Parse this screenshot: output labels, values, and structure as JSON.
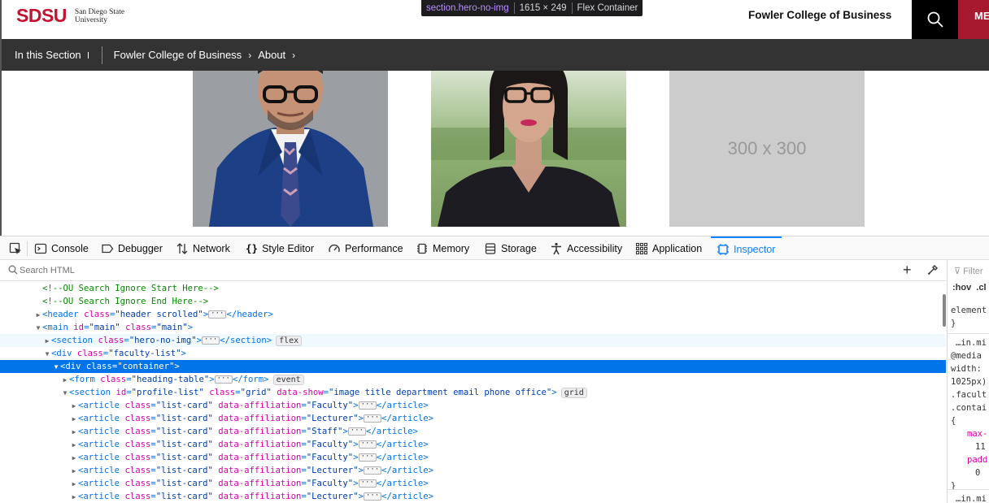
{
  "site": {
    "logo_text": "SDSU",
    "logo_sub_line1": "San Diego State",
    "logo_sub_line2": "University",
    "college_name": "Fowler College of Business",
    "menu_label": "ME",
    "in_this_section": "In this Section",
    "breadcrumbs": [
      "Fowler College of Business",
      "About"
    ],
    "placeholder_image_text": "300 x 300"
  },
  "tooltip": {
    "selector": "section.hero-no-img",
    "dimensions": "1615 × 249",
    "kind": "Flex Container"
  },
  "devtools": {
    "tabs": [
      {
        "label": "Console",
        "icon": "console-icon"
      },
      {
        "label": "Debugger",
        "icon": "debugger-icon"
      },
      {
        "label": "Network",
        "icon": "network-icon"
      },
      {
        "label": "Style Editor",
        "icon": "style-editor-icon"
      },
      {
        "label": "Performance",
        "icon": "performance-icon"
      },
      {
        "label": "Memory",
        "icon": "memory-icon"
      },
      {
        "label": "Storage",
        "icon": "storage-icon"
      },
      {
        "label": "Accessibility",
        "icon": "accessibility-icon"
      },
      {
        "label": "Application",
        "icon": "application-icon"
      },
      {
        "label": "Inspector",
        "icon": "inspector-icon",
        "active": true
      }
    ],
    "search_placeholder": "Search HTML",
    "rules_panel": {
      "filter_placeholder": "Filter",
      "hov": ":hov",
      "cls": ".cl",
      "lines": [
        "element",
        "}",
        "…in.mi",
        "@media",
        "width:",
        "1025px)",
        ".facult",
        ".contai",
        "{",
        "max-",
        "11",
        "padd",
        "0",
        "}",
        "…in.mi"
      ]
    },
    "tree": [
      {
        "indent": 0,
        "type": "comment",
        "text": "<!--OU Search Ignore Start Here-->"
      },
      {
        "indent": 0,
        "type": "comment",
        "text": "<!--OU Search Ignore End Here-->"
      },
      {
        "indent": 0,
        "toggle": "▶",
        "tag": "header",
        "attrs": [
          [
            "class",
            "header scrolled"
          ]
        ],
        "collapsed": true
      },
      {
        "indent": 0,
        "toggle": "▼",
        "tag": "main",
        "attrs": [
          [
            "id",
            "main"
          ],
          [
            "class",
            "main"
          ]
        ]
      },
      {
        "indent": 1,
        "toggle": "▶",
        "tag": "section",
        "attrs": [
          [
            "class",
            "hero-no-img"
          ]
        ],
        "collapsed": true,
        "badge": "flex",
        "hover": true
      },
      {
        "indent": 1,
        "toggle": "▼",
        "tag": "div",
        "attrs": [
          [
            "class",
            "faculty-list"
          ]
        ]
      },
      {
        "indent": 2,
        "toggle": "▼",
        "tag": "div",
        "attrs": [
          [
            "class",
            "container"
          ]
        ],
        "selected": true
      },
      {
        "indent": 3,
        "toggle": "▶",
        "tag": "form",
        "attrs": [
          [
            "class",
            "heading-table"
          ]
        ],
        "collapsed": true,
        "badge": "event"
      },
      {
        "indent": 3,
        "toggle": "▼",
        "tag": "section",
        "attrs": [
          [
            "id",
            "profile-list"
          ],
          [
            "class",
            "grid"
          ],
          [
            "data-show",
            "image title department email phone office"
          ]
        ],
        "badge": "grid"
      },
      {
        "indent": 4,
        "toggle": "▶",
        "tag": "article",
        "attrs": [
          [
            "class",
            "list-card"
          ],
          [
            "data-affiliation",
            "Faculty"
          ]
        ],
        "collapsed": true
      },
      {
        "indent": 4,
        "toggle": "▶",
        "tag": "article",
        "attrs": [
          [
            "class",
            "list-card"
          ],
          [
            "data-affiliation",
            "Lecturer"
          ]
        ],
        "collapsed": true
      },
      {
        "indent": 4,
        "toggle": "▶",
        "tag": "article",
        "attrs": [
          [
            "class",
            "list-card"
          ],
          [
            "data-affiliation",
            "Staff"
          ]
        ],
        "collapsed": true
      },
      {
        "indent": 4,
        "toggle": "▶",
        "tag": "article",
        "attrs": [
          [
            "class",
            "list-card"
          ],
          [
            "data-affiliation",
            "Faculty"
          ]
        ],
        "collapsed": true
      },
      {
        "indent": 4,
        "toggle": "▶",
        "tag": "article",
        "attrs": [
          [
            "class",
            "list-card"
          ],
          [
            "data-affiliation",
            "Faculty"
          ]
        ],
        "collapsed": true
      },
      {
        "indent": 4,
        "toggle": "▶",
        "tag": "article",
        "attrs": [
          [
            "class",
            "list-card"
          ],
          [
            "data-affiliation",
            "Lecturer"
          ]
        ],
        "collapsed": true
      },
      {
        "indent": 4,
        "toggle": "▶",
        "tag": "article",
        "attrs": [
          [
            "class",
            "list-card"
          ],
          [
            "data-affiliation",
            "Faculty"
          ]
        ],
        "collapsed": true
      },
      {
        "indent": 4,
        "toggle": "▶",
        "tag": "article",
        "attrs": [
          [
            "class",
            "list-card"
          ],
          [
            "data-affiliation",
            "Lecturer"
          ]
        ],
        "collapsed": true
      },
      {
        "indent": 4,
        "toggle": "▶",
        "tag": "article",
        "attrs": [
          [
            "class",
            "list-card"
          ],
          [
            "data-affiliation",
            "Lecturer"
          ]
        ],
        "collapsed": true
      }
    ]
  },
  "colors": {
    "brand_red": "#c41230",
    "menu_red": "#a6192e",
    "section_bar": "#333333",
    "selection_blue": "#0074e8",
    "active_tab": "#0a84ff"
  }
}
